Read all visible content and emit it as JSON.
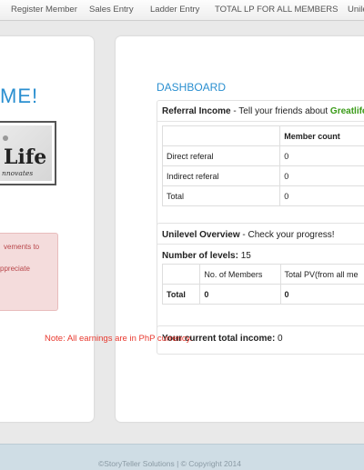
{
  "nav": {
    "items": [
      {
        "label": "Register Member"
      },
      {
        "label": "Sales Entry"
      },
      {
        "label": "Ladder Entry"
      },
      {
        "label": "TOTAL LP FOR ALL MEMBERS"
      },
      {
        "label": "Unile"
      }
    ]
  },
  "left": {
    "welcome": "ME!",
    "logo_word": "Life",
    "logo_tag": "nnovates",
    "alert_lines": [
      "vements to",
      "ppreciate"
    ]
  },
  "dashboard": {
    "title": "DASHBOARD",
    "referral": {
      "title_bold": "Referral Income",
      "title_text": " - Tell your friends about ",
      "title_brand": "Greatlife",
      "header": "Member count",
      "rows": [
        {
          "label": "Direct referal",
          "count": "0"
        },
        {
          "label": "Indirect referal",
          "count": "0"
        },
        {
          "label": "Total",
          "count": "0"
        }
      ]
    },
    "unilevel": {
      "title_bold": "Unilevel Overview",
      "title_text": " - Check your progress!",
      "levels_label": "Number of levels:",
      "levels_value": " 15",
      "col_members": "No. of Members",
      "col_pv": "Total PV(from all me",
      "total_label": "Total",
      "total_members": "0",
      "total_pv": "0"
    },
    "income": {
      "label": "Your current total income:",
      "value": " 0"
    },
    "note": "Note: All earnings are in PhP currency."
  },
  "footer": {
    "text": "©StoryTeller Solutions | © Copyright 2014"
  },
  "colors": {
    "accent": "#2a8fd0",
    "brand_green": "#3a9b18",
    "note_red": "#e8392f"
  }
}
